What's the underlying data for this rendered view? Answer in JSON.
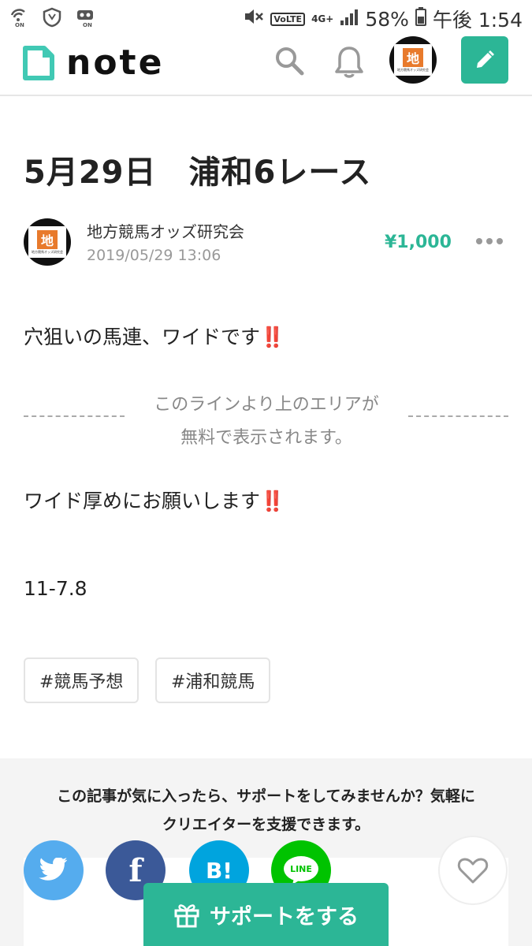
{
  "status_bar": {
    "left_badges": [
      "ON",
      "ON"
    ],
    "network": "4G+",
    "volte": "VoLTE",
    "battery": "58%",
    "time": "午後 1:54"
  },
  "header": {
    "logo_text": "note",
    "avatar_char": "地",
    "avatar_subtext": "地方競馬オッズ研究会",
    "accent_color": "#2cb696"
  },
  "article": {
    "title": "5月29日　浦和6レース",
    "author": "地方競馬オッズ研究会",
    "date": "2019/05/29 13:06",
    "price": "¥1,000",
    "paragraph1": "穴狙いの馬連、ワイドです",
    "paragraph1_mark": "‼️",
    "free_line_1": "このラインより上のエリアが",
    "free_line_2": "無料で表示されます。",
    "paragraph2": "ワイド厚めにお願いします",
    "paragraph2_mark": "‼️",
    "paragraph3": "11-7.8",
    "tags": [
      "#競馬予想",
      "#浦和競馬"
    ]
  },
  "support": {
    "line1": "この記事が気に入ったら、サポートをしてみませんか？気軽に",
    "line2": "クリエイターを支援できます。",
    "button_label": "サポートをする",
    "share": {
      "hatena_label": "B!",
      "line_label": "LINE",
      "twitter_color": "#55acee",
      "facebook_color": "#3b5998",
      "hatena_color": "#00a4de",
      "line_color": "#00c300"
    }
  }
}
